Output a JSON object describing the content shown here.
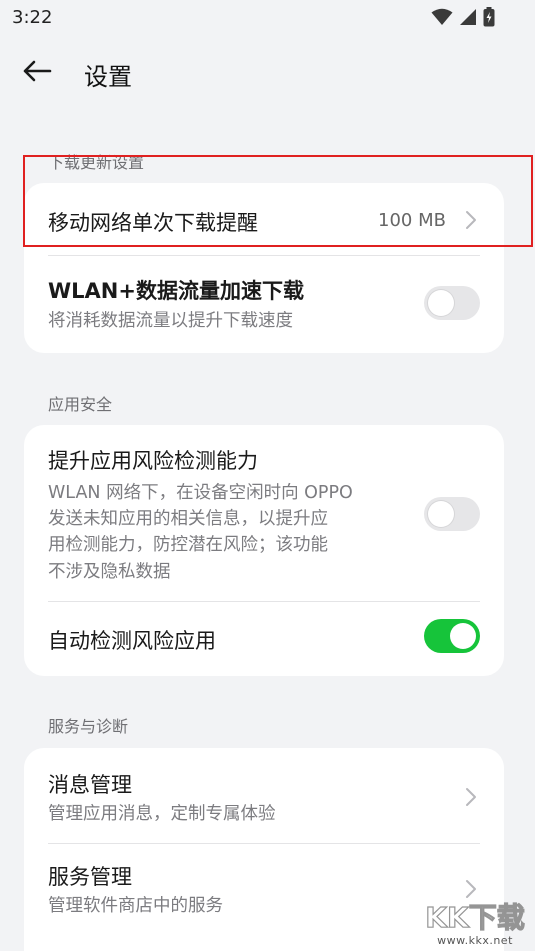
{
  "status_bar": {
    "time": "3:22"
  },
  "header": {
    "title": "设置"
  },
  "sections": [
    {
      "header": "下载更新设置",
      "items": [
        {
          "title": "移动网络单次下载提醒",
          "value": "100 MB"
        },
        {
          "title": "WLAN+数据流量加速下载",
          "subtitle": "将消耗数据流量以提升下载速度",
          "toggle": "off"
        }
      ]
    },
    {
      "header": "应用安全",
      "items": [
        {
          "title": "提升应用风险检测能力",
          "subtitle_lines": [
            "WLAN 网络下，在设备空闲时向 OPPO",
            "发送未知应用的相关信息，以提升应",
            "用检测能力，防控潜在风险；该功能",
            "不涉及隐私数据"
          ],
          "toggle": "off"
        },
        {
          "title": "自动检测风险应用",
          "toggle": "on"
        }
      ]
    },
    {
      "header": "服务与诊断",
      "items": [
        {
          "title": "消息管理",
          "subtitle": "管理应用消息，定制专属体验"
        },
        {
          "title": "服务管理",
          "subtitle": "管理软件商店中的服务"
        }
      ]
    }
  ],
  "watermark": {
    "logo_text": "KK下载",
    "url": "www.kkx.net"
  },
  "colors": {
    "background": "#f2f3f5",
    "toggle_on": "#16c43a",
    "highlight": "#e02020"
  }
}
